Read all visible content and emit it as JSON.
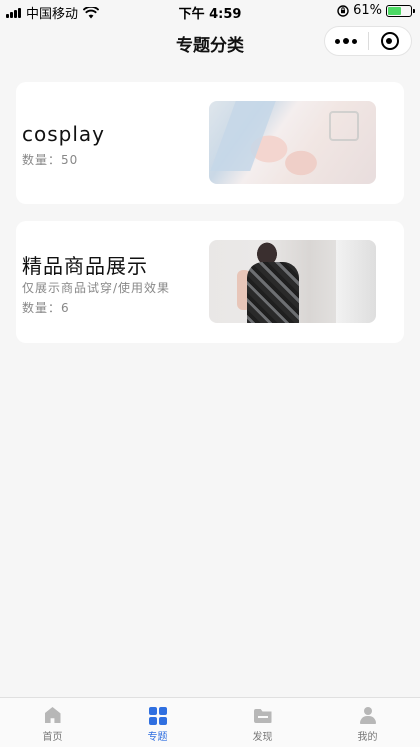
{
  "status_bar": {
    "carrier": "中国移动",
    "time": "下午 4:59",
    "battery_percent": "61%",
    "battery_level": 0.61
  },
  "nav": {
    "title": "专题分类"
  },
  "categories": [
    {
      "title": "cosplay",
      "count_label": "数量：50",
      "thumbnail": "cosplay-photo"
    },
    {
      "title": "精品商品展示",
      "description": "仅展示商品试穿/使用效果",
      "count_label": "数量：6",
      "thumbnail": "product-photo"
    }
  ],
  "tab_bar": {
    "items": [
      {
        "label": "首页",
        "icon": "home-icon"
      },
      {
        "label": "专题",
        "icon": "grid-icon",
        "active": true
      },
      {
        "label": "发现",
        "icon": "folder-icon"
      },
      {
        "label": "我的",
        "icon": "user-icon"
      }
    ],
    "active_color": "#2f6fe0",
    "inactive_color": "#b7b7b7"
  }
}
